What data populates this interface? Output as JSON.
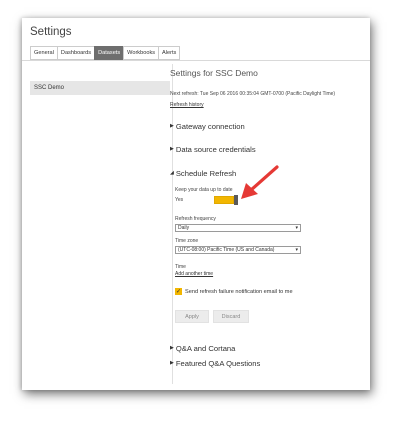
{
  "page": {
    "title": "Settings"
  },
  "tabs": [
    {
      "label": "General"
    },
    {
      "label": "Dashboards"
    },
    {
      "label": "Datasets",
      "active": true
    },
    {
      "label": "Workbooks"
    },
    {
      "label": "Alerts"
    }
  ],
  "sidebar": {
    "items": [
      {
        "label": "SSC Demo"
      }
    ]
  },
  "main": {
    "title": "Settings for SSC Demo",
    "next_refresh": "Next refresh: Tue Sep 06 2016 00:35:04 GMT-0700 (Pacific Daylight Time)",
    "refresh_history": "Refresh history",
    "sections": {
      "gateway": "Gateway connection",
      "credentials": "Data source credentials",
      "schedule": "Schedule Refresh",
      "qa": "Q&A and Cortana",
      "featured": "Featured Q&A Questions"
    },
    "schedule": {
      "keep_label": "Keep your data up to date",
      "toggle_value": "Yes",
      "toggle_on": true,
      "frequency_label": "Refresh frequency",
      "frequency_value": "Daily",
      "timezone_label": "Time zone",
      "timezone_value": "(UTC-08:00) Pacific Time (US and Canada)",
      "time_label": "Time",
      "add_time": "Add another time",
      "notify_label": "Send refresh failure notification email to me",
      "notify_checked": true,
      "apply": "Apply",
      "discard": "Discard"
    }
  },
  "colors": {
    "accent": "#f2b600",
    "active_tab": "#6e6e6e",
    "arrow": "#e53935"
  },
  "icons": {
    "collapsed": "triangle-right-icon",
    "expanded": "triangle-down-icon",
    "dropdown": "chevron-down-icon",
    "check": "checkmark-icon",
    "annotation": "red-arrow-icon"
  }
}
